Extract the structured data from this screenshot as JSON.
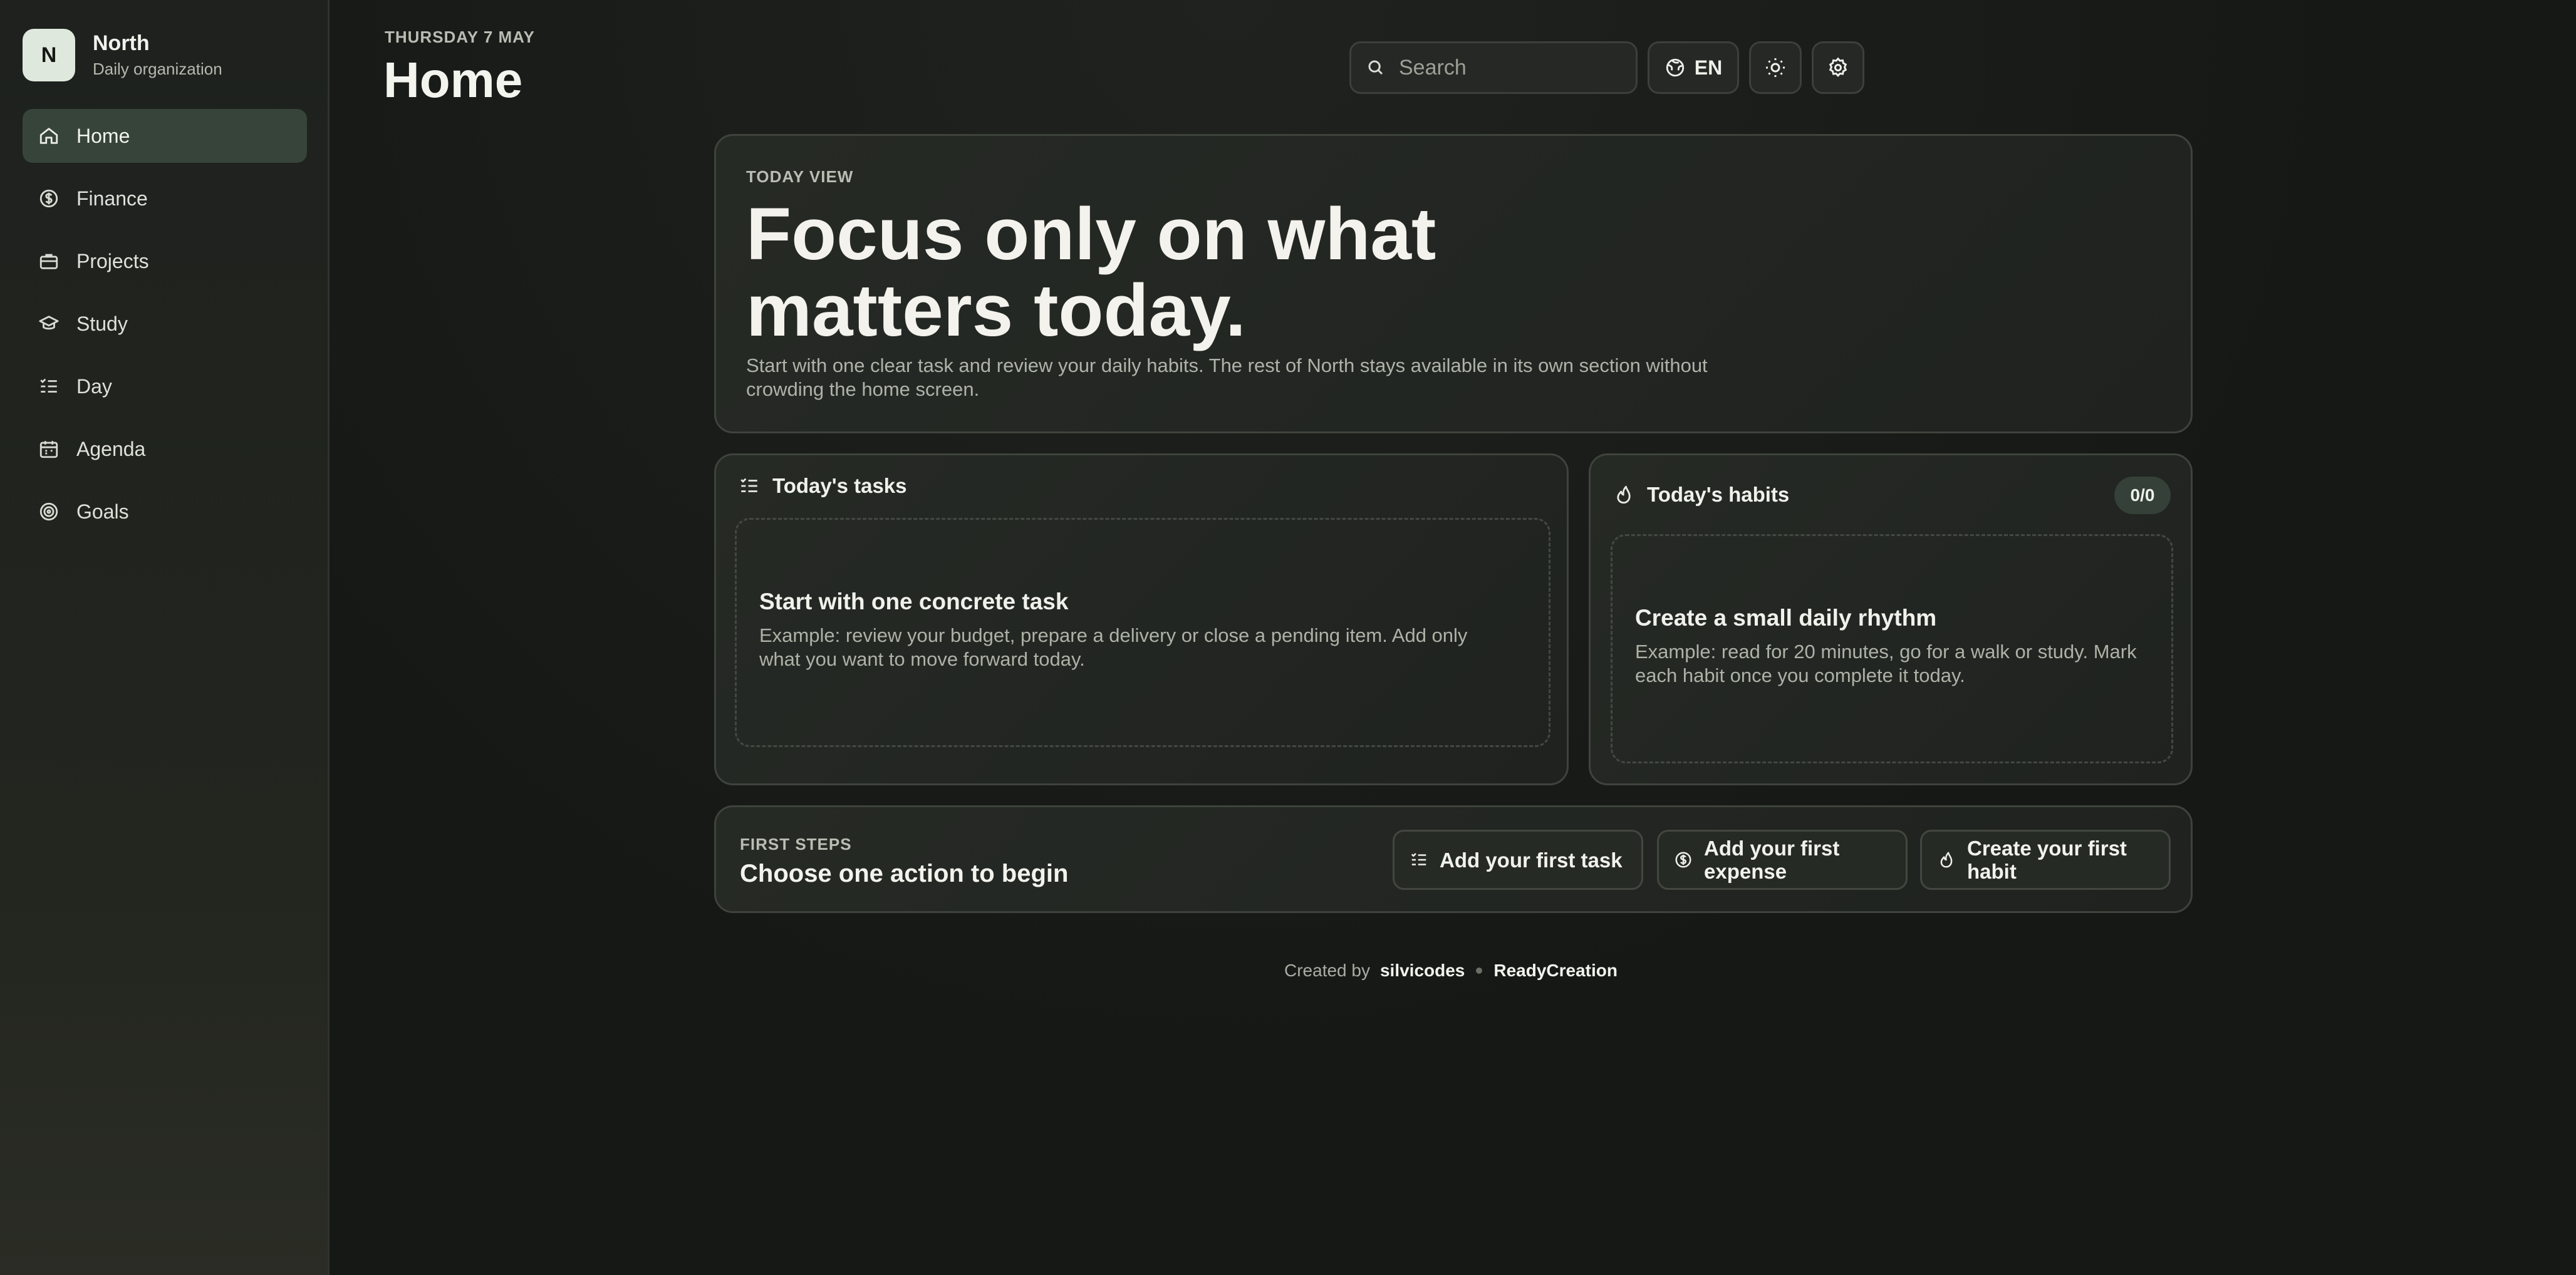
{
  "brand": {
    "mark": "N",
    "name": "North",
    "subtitle": "Daily organization"
  },
  "sidebar": {
    "items": [
      {
        "label": "Home",
        "icon": "home-icon",
        "active": true
      },
      {
        "label": "Finance",
        "icon": "dollar-icon"
      },
      {
        "label": "Projects",
        "icon": "briefcase-icon"
      },
      {
        "label": "Study",
        "icon": "graduation-cap-icon"
      },
      {
        "label": "Day",
        "icon": "checklist-icon"
      },
      {
        "label": "Agenda",
        "icon": "calendar-icon"
      },
      {
        "label": "Goals",
        "icon": "target-icon"
      }
    ]
  },
  "header": {
    "date": "THURSDAY 7 MAY",
    "title": "Home"
  },
  "toolbar": {
    "search_placeholder": "Search",
    "language": "EN"
  },
  "hero": {
    "eyebrow": "TODAY VIEW",
    "headline": "Focus only on what matters today.",
    "description": "Start with one clear task and review your daily habits. The rest of North stays available in its own section without crowding the home screen."
  },
  "tasks": {
    "title": "Today's tasks",
    "empty_title": "Start with one concrete task",
    "empty_text": "Example: review your budget, prepare a delivery or close a pending item. Add only what you want to move forward today."
  },
  "habits": {
    "title": "Today's habits",
    "count": "0/0",
    "empty_title": "Create a small daily rhythm",
    "empty_text": "Example: read for 20 minutes, go for a walk or study. Mark each habit once you complete it today."
  },
  "first_steps": {
    "eyebrow": "FIRST STEPS",
    "title": "Choose one action to begin",
    "actions": [
      {
        "label": "Add your first task",
        "icon": "checklist-icon"
      },
      {
        "label": "Add your first expense",
        "icon": "dollar-icon"
      },
      {
        "label": "Create your first habit",
        "icon": "flame-icon"
      }
    ]
  },
  "footer": {
    "created_by": "Created by",
    "author": "silvicodes",
    "company": "ReadyCreation"
  }
}
